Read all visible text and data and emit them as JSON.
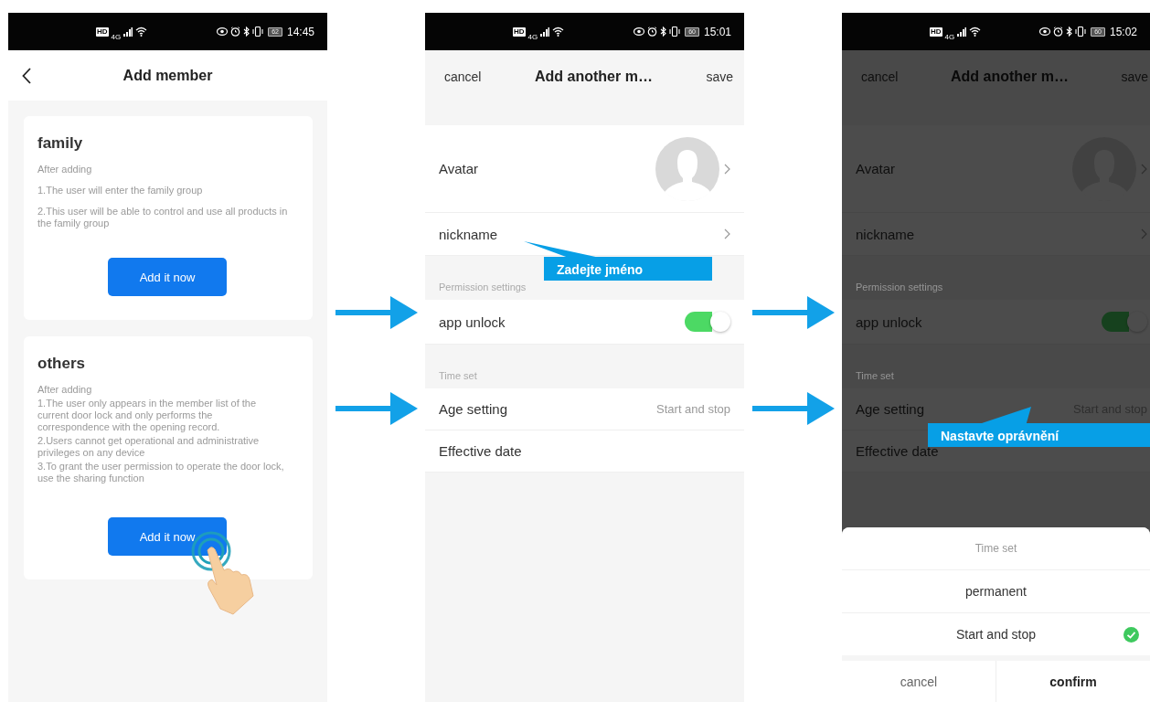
{
  "screens": [
    {
      "kind": "member_type",
      "status_bar": {
        "hd": "HD",
        "network": "4G",
        "battery": "62",
        "time": "14:45"
      },
      "header": {
        "title": "Add member"
      },
      "cards": [
        {
          "title": "family",
          "lines": [
            "After adding",
            "1.The user will enter the family group",
            "2.This user will be able to control and use all products in the family group"
          ],
          "button": "Add it now",
          "tapped": false
        },
        {
          "title": "others",
          "lines": [
            "After adding",
            "1.The user only appears in the member list of the current door lock and only performs the correspondence with the opening record.",
            "2.Users cannot get operational and administrative privileges on any device",
            "3.To grant the user permission to operate the door lock, use the sharing function"
          ],
          "button": "Add it now",
          "tapped": true
        }
      ]
    },
    {
      "kind": "member_form",
      "dimmed": false,
      "status_bar": {
        "hd": "HD",
        "network": "4G",
        "battery": "60",
        "time": "15:01"
      },
      "header": {
        "cancel": "cancel",
        "title": "Add another m…",
        "save": "save"
      },
      "rows": [
        {
          "kind": "avatar",
          "label": "Avatar"
        },
        {
          "kind": "link",
          "label": "nickname"
        },
        {
          "kind": "section",
          "label": "Permission settings"
        },
        {
          "kind": "toggle",
          "label": "app unlock",
          "on": true
        },
        {
          "kind": "section",
          "label": "Time set"
        },
        {
          "kind": "value",
          "label": "Age setting",
          "value": "Start and stop"
        },
        {
          "kind": "plain",
          "label": "Effective date"
        }
      ],
      "callout": {
        "text": "Zadejte jméno"
      }
    },
    {
      "kind": "member_form",
      "dimmed": true,
      "status_bar": {
        "hd": "HD",
        "network": "4G",
        "battery": "60",
        "time": "15:02"
      },
      "header": {
        "cancel": "cancel",
        "title": "Add another m…",
        "save": "save"
      },
      "rows": [
        {
          "kind": "avatar",
          "label": "Avatar"
        },
        {
          "kind": "link",
          "label": "nickname"
        },
        {
          "kind": "section",
          "label": "Permission settings"
        },
        {
          "kind": "toggle",
          "label": "app unlock",
          "on": true
        },
        {
          "kind": "section",
          "label": "Time set"
        },
        {
          "kind": "value",
          "label": "Age setting",
          "value": "Start and stop"
        },
        {
          "kind": "plain",
          "label": "Effective date"
        }
      ],
      "callout": {
        "text": "Nastavte oprávnění"
      },
      "sheet": {
        "title": "Time set",
        "options": [
          {
            "label": "permanent",
            "selected": false
          },
          {
            "label": "Start and stop",
            "selected": true
          }
        ],
        "cancel": "cancel",
        "confirm": "confirm"
      }
    }
  ]
}
